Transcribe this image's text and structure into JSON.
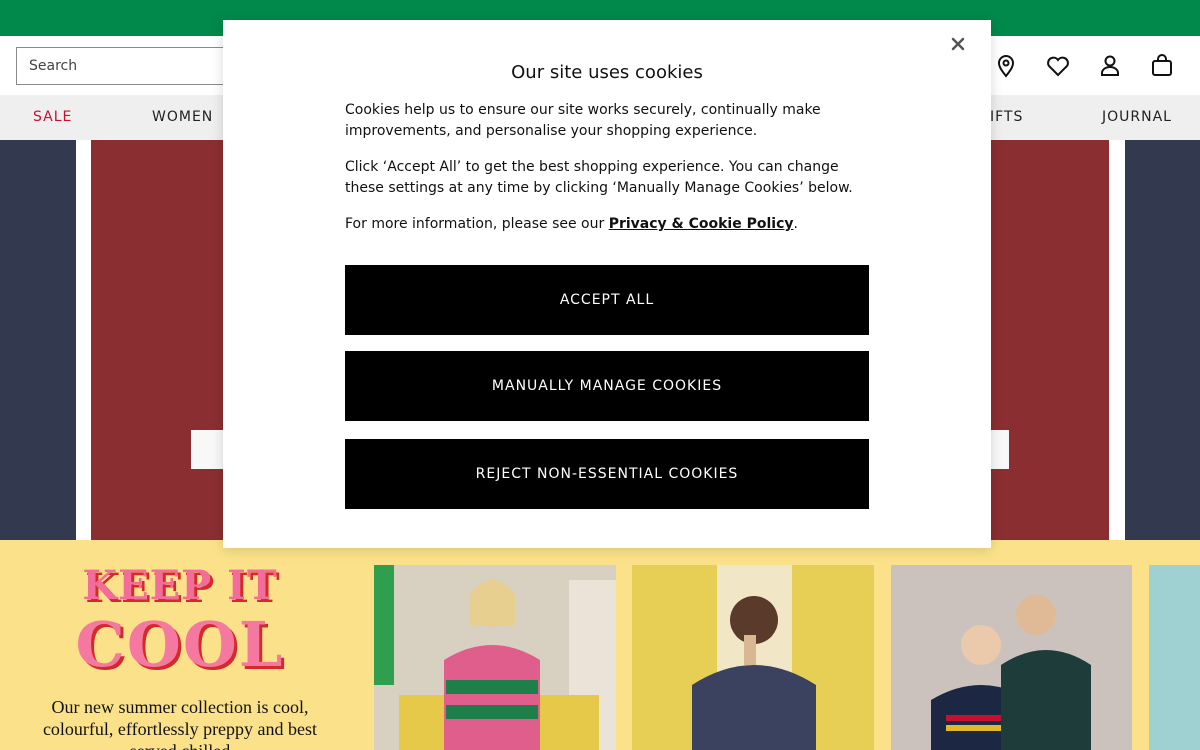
{
  "search": {
    "placeholder": "Search"
  },
  "nav": {
    "items": [
      "SALE",
      "WOMEN",
      "IFTS",
      "JOURNAL"
    ]
  },
  "promo": {
    "line1": "KEEP IT",
    "line2": "COOL",
    "text": "Our new summer collection is cool, colourful, effortlessly preppy and best served chilled"
  },
  "cookie": {
    "title": "Our site uses cookies",
    "para1": "Cookies help us to ensure our site works securely, continually make improvements, and personalise your shopping experience.",
    "para2": "Click ‘Accept All’ to get the best shopping experience. You can change these settings at any time by clicking ‘Manually Manage Cookies’ below.",
    "para3_prefix": "For more information, please see our ",
    "policy_link": "Privacy & Cookie Policy",
    "para3_suffix": ".",
    "accept": "ACCEPT ALL",
    "manage": "MANUALLY MANAGE COOKIES",
    "reject": "REJECT NON-ESSENTIAL COOKIES"
  },
  "colors": {
    "topbar": "#00894a",
    "sale": "#c8102e",
    "hero_red": "#8b2e31",
    "navy": "#33394f",
    "promo_bg": "#fbe28a",
    "promo_pink": "#f4789f"
  },
  "icons": [
    "location-pin-icon",
    "heart-icon",
    "user-icon",
    "bag-icon",
    "close-icon"
  ]
}
